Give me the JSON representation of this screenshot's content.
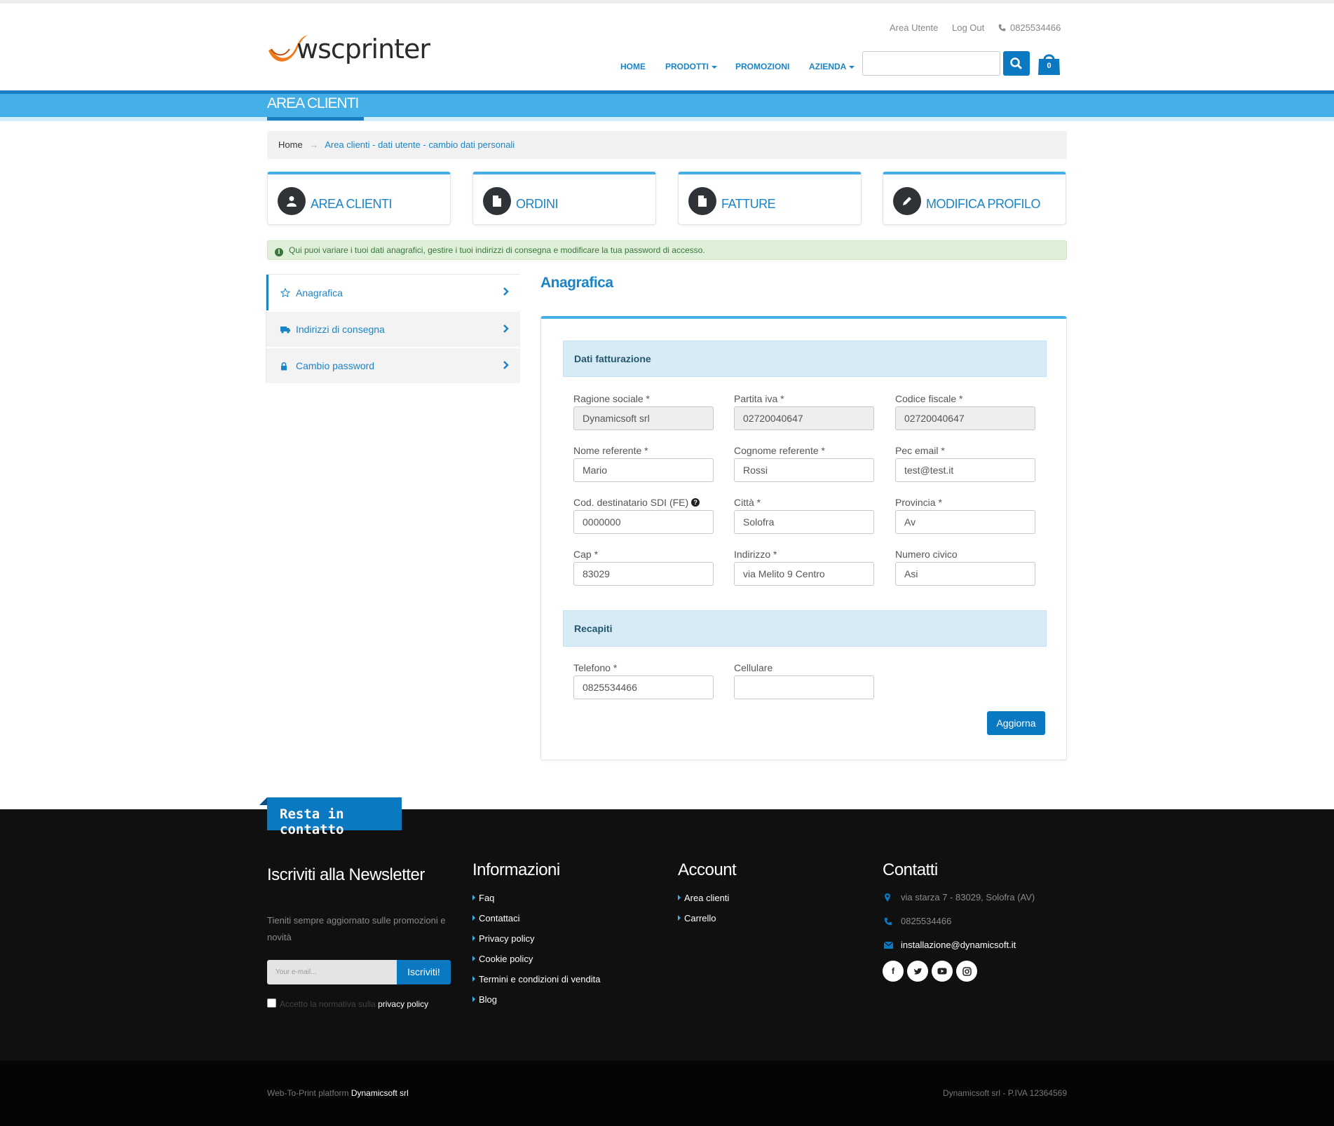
{
  "header": {
    "logo_text": "wscprinter",
    "top_links": {
      "area_utente": "Area Utente",
      "logout": "Log Out",
      "phone": "0825534466"
    },
    "nav": [
      "HOME",
      "PRODOTTI",
      "PROMOZIONI",
      "AZIENDA"
    ],
    "search_placeholder": "",
    "cart_count": "0"
  },
  "band_title": "AREA CLIENTI",
  "breadcrumb": {
    "home": "Home",
    "current": "Area clienti - dati utente - cambio dati personali"
  },
  "cards": [
    "AREA CLIENTI",
    "ORDINI",
    "FATTURE",
    "MODIFICA PROFILO"
  ],
  "alert": "Qui puoi variare i tuoi dati anagrafici, gestire i tuoi indirizzi di consegna e modificare la tua password di accesso.",
  "side_menu": [
    "Anagrafica",
    "Indirizzi di consegna",
    "Cambio password"
  ],
  "content": {
    "title": "Anagrafica",
    "section_billing": "Dati fatturazione",
    "section_contacts": "Recapiti",
    "fields": {
      "ragione_sociale": {
        "label": "Ragione sociale *",
        "value": "Dynamicsoft srl"
      },
      "partita_iva": {
        "label": "Partita iva *",
        "value": "02720040647"
      },
      "codice_fiscale": {
        "label": "Codice fiscale *",
        "value": "02720040647"
      },
      "nome_referente": {
        "label": "Nome referente *",
        "value": "Mario"
      },
      "cognome_referente": {
        "label": "Cognome referente *",
        "value": "Rossi"
      },
      "pec_email": {
        "label": "Pec email *",
        "value": "test@test.it"
      },
      "cod_sdi": {
        "label": "Cod. destinatario SDI (FE)",
        "value": "0000000"
      },
      "citta": {
        "label": "Città *",
        "value": "Solofra"
      },
      "provincia": {
        "label": "Provincia *",
        "value": "Av"
      },
      "cap": {
        "label": "Cap *",
        "value": "83029"
      },
      "indirizzo": {
        "label": "Indirizzo *",
        "value": "via Melito 9 Centro"
      },
      "numero_civico": {
        "label": "Numero civico",
        "value": "Asi"
      },
      "telefono": {
        "label": "Telefono *",
        "value": "0825534466"
      },
      "cellulare": {
        "label": "Cellulare",
        "value": ""
      }
    },
    "update_button": "Aggiorna"
  },
  "footer": {
    "tab": "Resta in contatto",
    "newsletter": {
      "title": "Iscriviti alla Newsletter",
      "text": "Tieniti sempre aggiornato sulle promozioni e novità",
      "placeholder": "Your e-mail...",
      "button": "Iscriviti!",
      "consent_prefix": "Accetto la normativa sulla",
      "consent_link": "privacy policy"
    },
    "info": {
      "title": "Informazioni",
      "links": [
        "Faq",
        "Contattaci",
        "Privacy policy",
        "Cookie policy",
        "Termini e condizioni di vendita",
        "Blog"
      ]
    },
    "account": {
      "title": "Account",
      "links": [
        "Area clienti",
        "Carrello"
      ]
    },
    "contacts": {
      "title": "Contatti",
      "address": "via starza 7 - 83029, Solofra (AV)",
      "phone": "0825534466",
      "email": "installazione@dynamicsoft.it",
      "social": [
        "f",
        "t",
        "yt",
        "ig"
      ]
    },
    "bottom_left_prefix": "Web-To-Print platform",
    "bottom_left_brand": "Dynamicsoft srl",
    "bottom_right": "Dynamicsoft srl - P.IVA 12364569"
  },
  "colors": {
    "primary": "#0b78c2",
    "band": "#44aee6",
    "link": "#1a84c7",
    "footer": "#101010"
  }
}
